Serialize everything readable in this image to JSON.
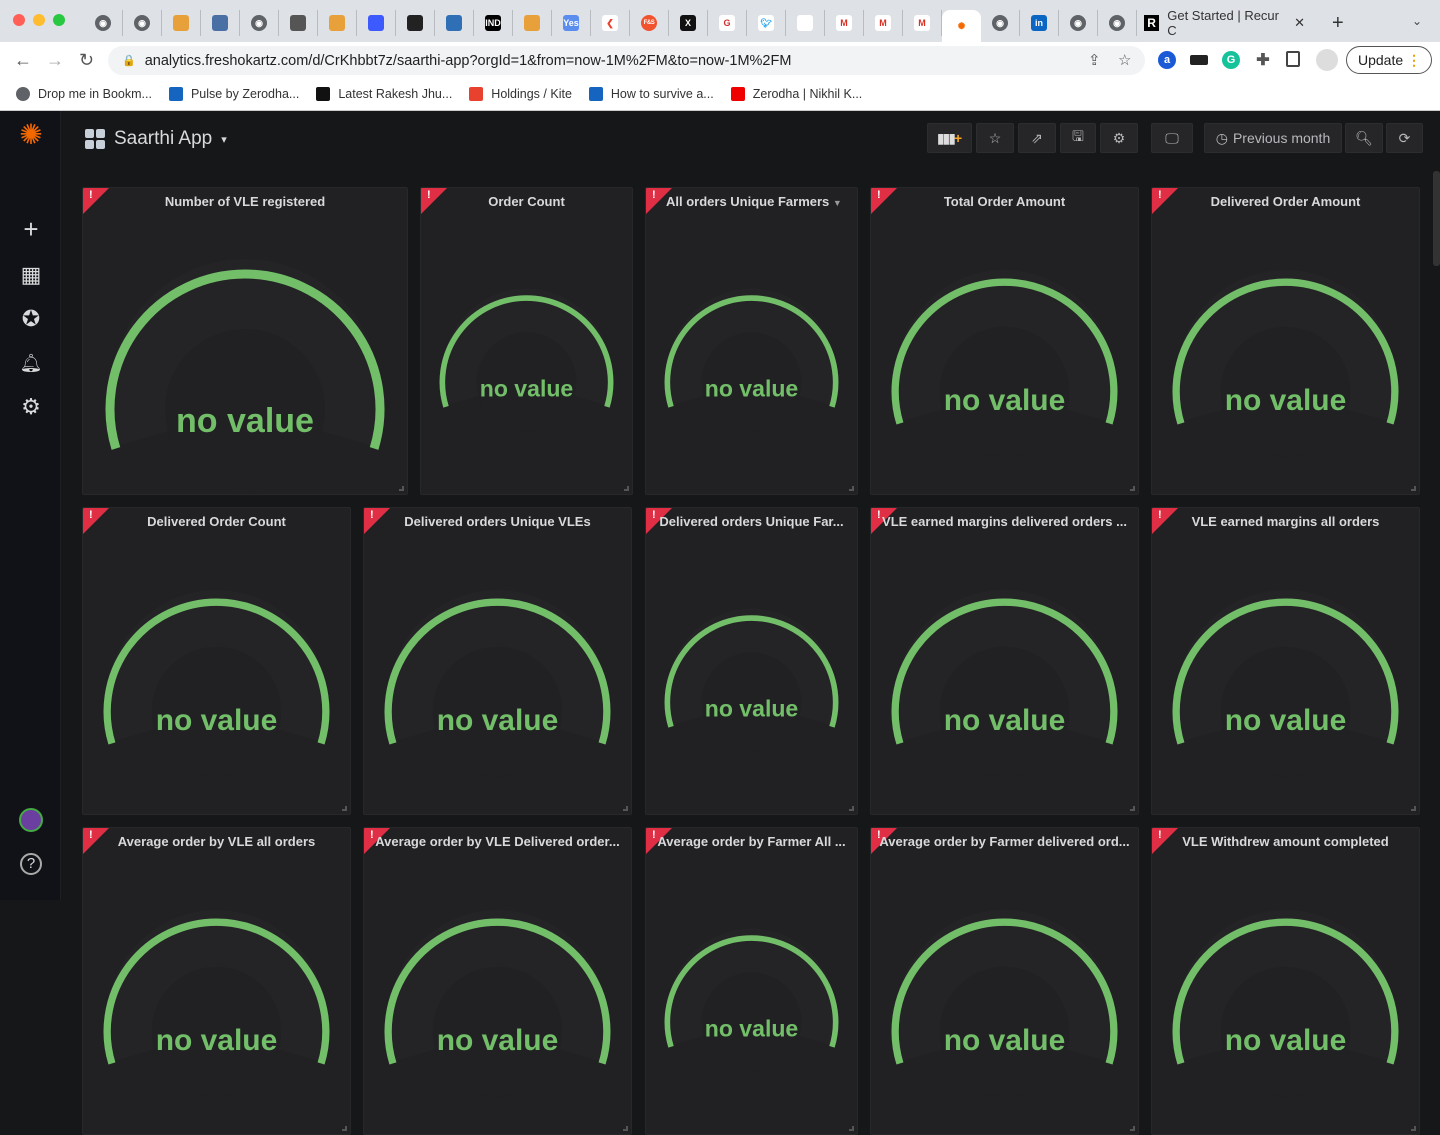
{
  "browser": {
    "tabs_icons": [
      "globe",
      "globe",
      "app",
      "play",
      "globe",
      "doc",
      "app",
      "chart",
      "tag",
      "trend",
      "ind",
      "app",
      "Yes",
      "kite",
      "F&S",
      "X",
      "G",
      "twitter",
      "network",
      "gmail",
      "gmail",
      "gmail",
      "grafana",
      "globe",
      "in",
      "globe",
      "globe"
    ],
    "active_tab_title": "Get Started | Recur C",
    "url": "analytics.freshokartz.com/d/CrKhbbt7z/saarthi-app?orgId=1&from=now-1M%2FM&to=now-1M%2FM",
    "update_label": "Update",
    "bookmarks": [
      "Drop me in Bookm...",
      "Pulse by Zerodha...",
      "Latest Rakesh Jhu...",
      "Holdings / Kite",
      "How to survive a...",
      "Zerodha | Nikhil K..."
    ]
  },
  "dashboard": {
    "title": "Saarthi App",
    "time_range": "Previous month",
    "gauge_color": "#73bf69",
    "error_color": "#e02f44",
    "no_value": "no value",
    "panels": [
      "Number of VLE registered",
      "Order Count",
      "All orders Unique Farmers",
      "Total Order Amount",
      "Delivered Order Amount",
      "Delivered Order Count",
      "Delivered orders Unique VLEs",
      "Delivered orders Unique Far...",
      "VLE earned margins delivered orders ...",
      "VLE earned margins all orders",
      "Average order by VLE all orders",
      "Average order by VLE Delivered order...",
      "Average order by Farmer All ...",
      "Average order by Farmer delivered ord...",
      "VLE Withdrew amount completed"
    ]
  }
}
